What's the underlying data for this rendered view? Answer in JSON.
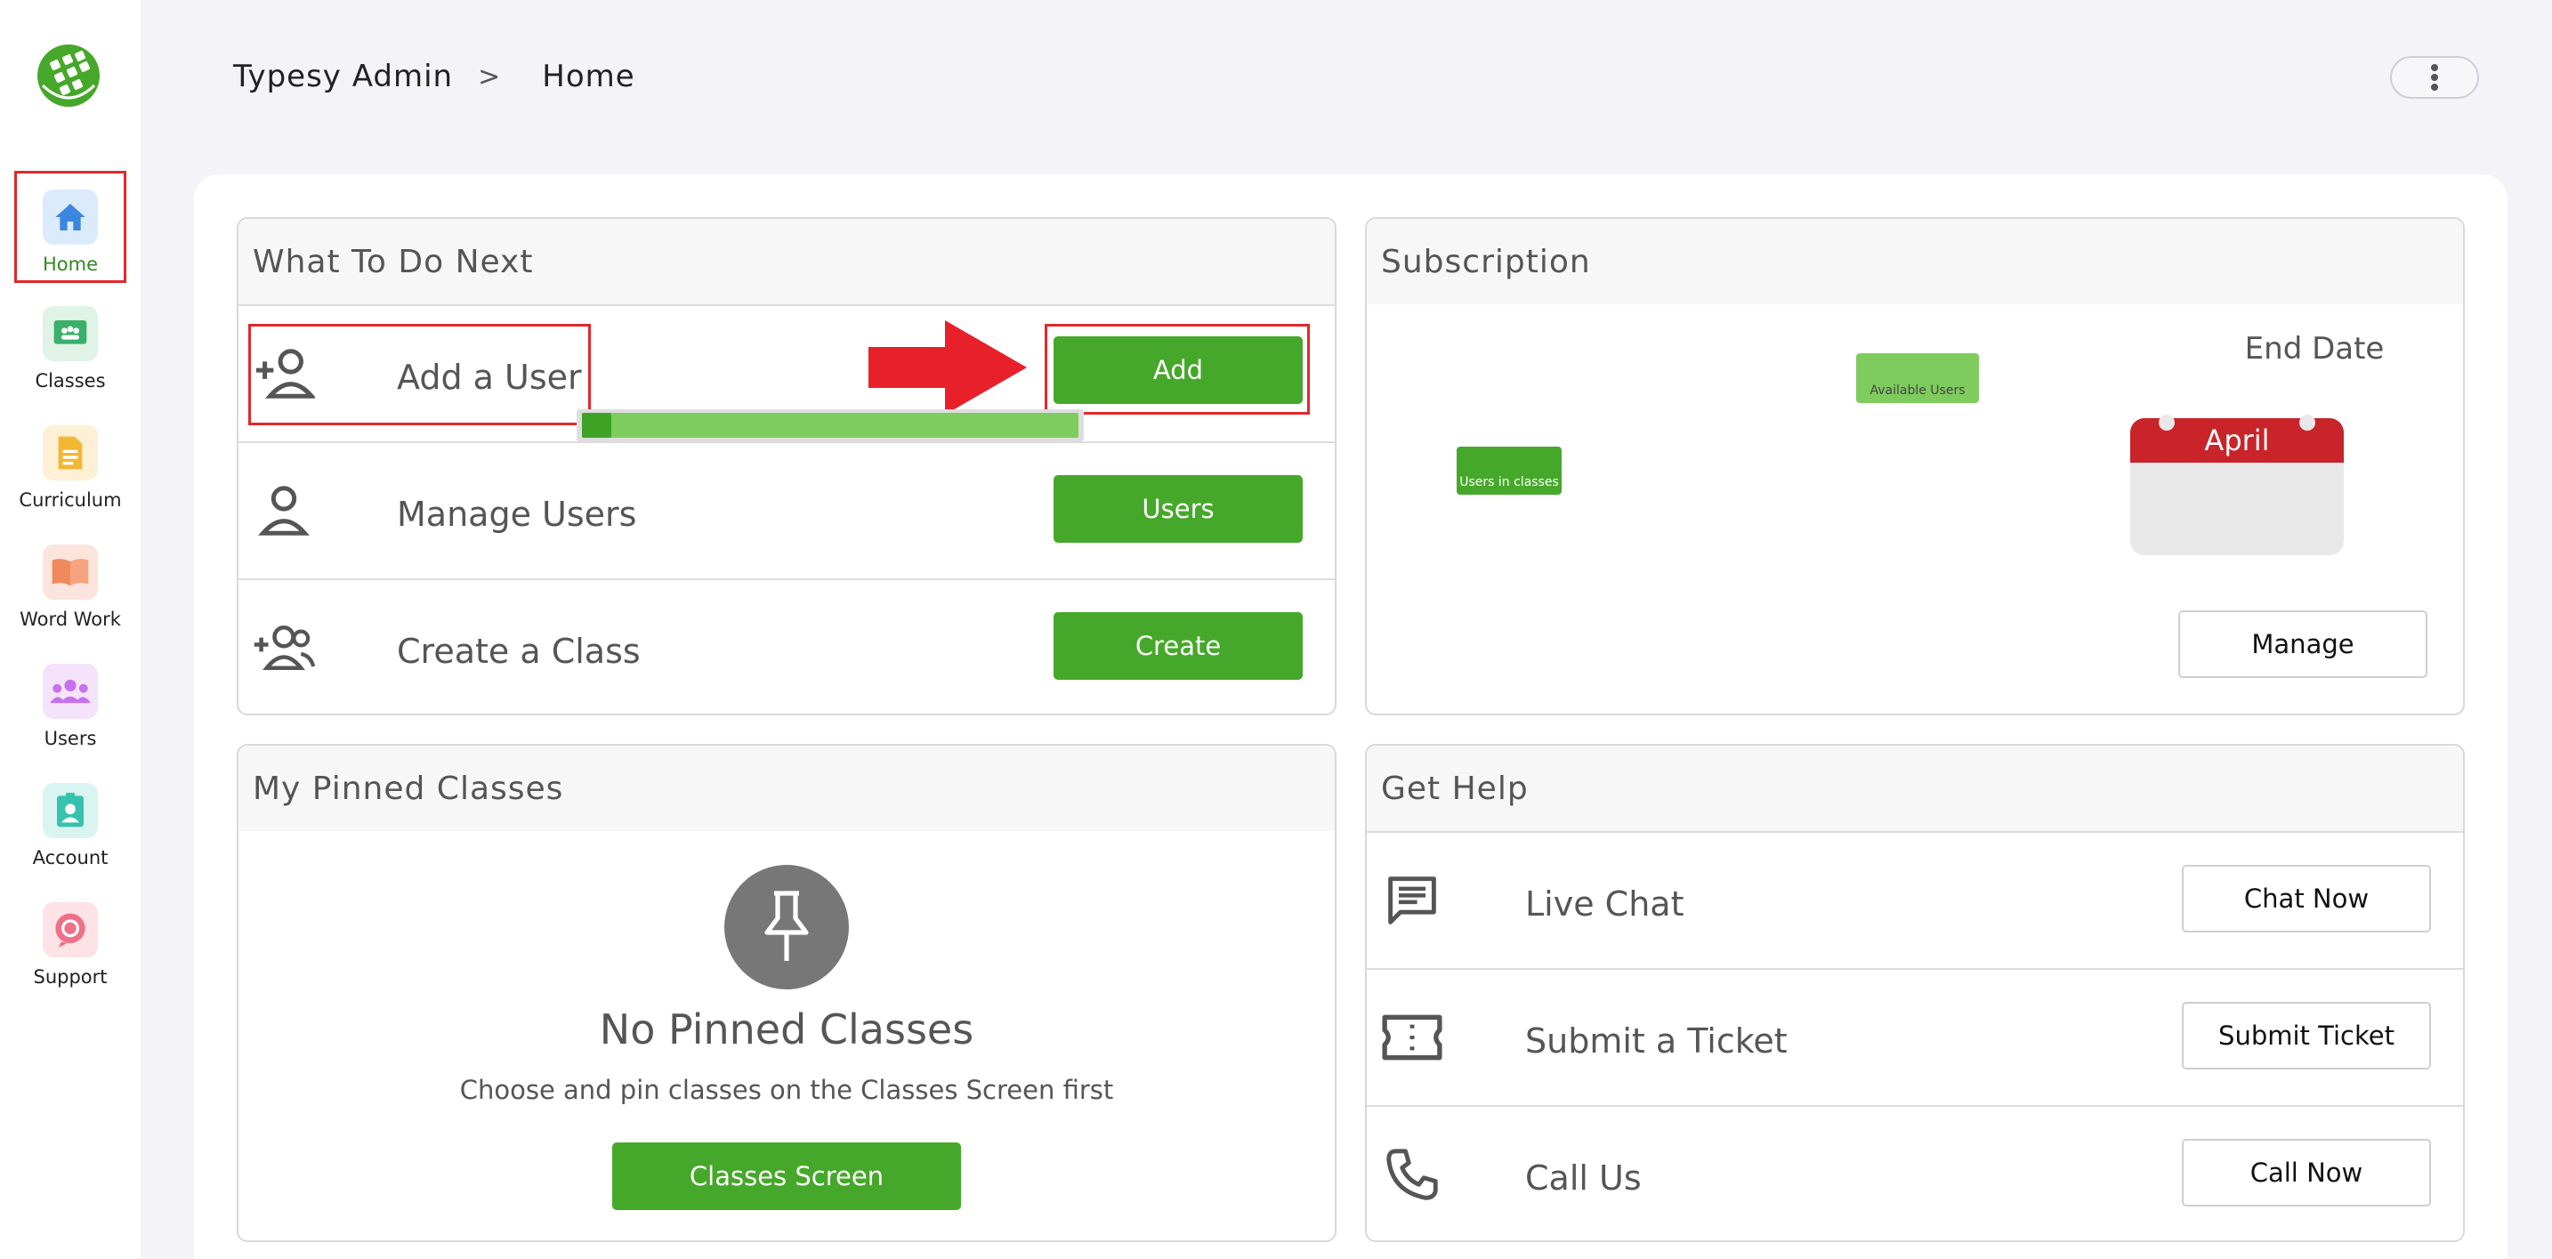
{
  "sidebar": {
    "items": [
      {
        "label": "Home",
        "icon": "home-icon",
        "bg": "#dcebfb",
        "fg": "#3b87e0"
      },
      {
        "label": "Classes",
        "icon": "classes-icon",
        "bg": "#dff3e6",
        "fg": "#3bb06a"
      },
      {
        "label": "Curriculum",
        "icon": "curriculum-icon",
        "bg": "#fdf0d4",
        "fg": "#f2b733"
      },
      {
        "label": "Word Work",
        "icon": "book-icon",
        "bg": "#fbe4dc",
        "fg": "#f08a5d"
      },
      {
        "label": "Users",
        "icon": "users-icon",
        "bg": "#f5e3fb",
        "fg": "#c572ec"
      },
      {
        "label": "Account",
        "icon": "account-icon",
        "bg": "#daf5f1",
        "fg": "#37c2ad"
      },
      {
        "label": "Support",
        "icon": "support-icon",
        "bg": "#fde2e6",
        "fg": "#ee7089"
      }
    ],
    "active": "Home"
  },
  "header": {
    "breadcrumb_root": "Typesy Admin",
    "breadcrumb_separator": ">",
    "breadcrumb_current": "Home"
  },
  "todo": {
    "title": "What To Do Next",
    "rows": [
      {
        "label": "Add a User",
        "button": "Add",
        "icon": "add-user-icon"
      },
      {
        "label": "Manage Users",
        "button": "Users",
        "icon": "user-icon"
      },
      {
        "label": "Create a Class",
        "button": "Create",
        "icon": "add-group-icon"
      }
    ]
  },
  "subscription": {
    "title": "Subscription",
    "available_label": "Available Users",
    "in_classes_label": "Users in classes",
    "in_classes_fraction": 0.06,
    "end_date_label": "End Date",
    "end_month": "April",
    "manage_button": "Manage"
  },
  "pinned": {
    "title": "My Pinned Classes",
    "empty_title": "No Pinned Classes",
    "empty_subtitle": "Choose and pin classes on the Classes Screen first",
    "button": "Classes Screen"
  },
  "help": {
    "title": "Get Help",
    "rows": [
      {
        "label": "Live Chat",
        "button": "Chat Now",
        "icon": "chat-icon"
      },
      {
        "label": "Submit a Ticket",
        "button": "Submit Ticket",
        "icon": "ticket-icon"
      },
      {
        "label": "Call Us",
        "button": "Call Now",
        "icon": "phone-icon"
      }
    ]
  },
  "colors": {
    "accent_green": "#46a82a",
    "highlight_red": "#e0282c",
    "calendar_red": "#c8242a"
  }
}
